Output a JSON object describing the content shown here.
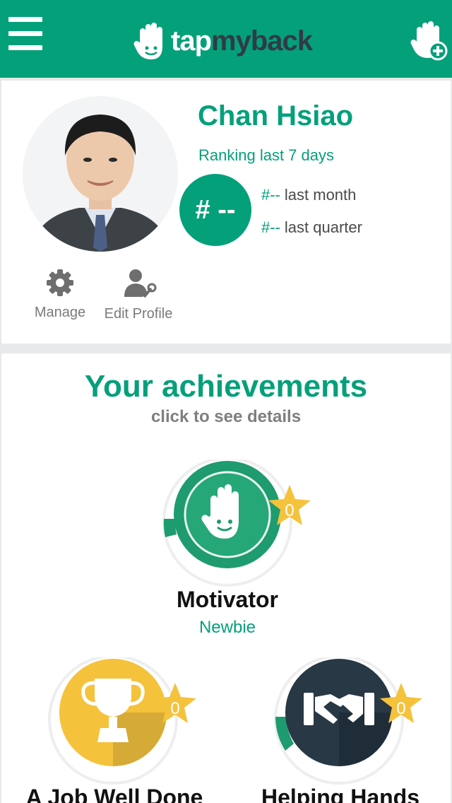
{
  "header": {
    "logo_prefix": "tap",
    "logo_suffix": "myback",
    "menu_icon": "hamburger-icon",
    "add_icon": "hand-plus-icon",
    "brand_color": "#04a07a"
  },
  "profile": {
    "name": "Chan Hsiao",
    "ranking_label": "Ranking last 7 days",
    "rank_value": "# --",
    "last_month_value": "#--",
    "last_month_label": "last month",
    "last_quarter_value": "#--",
    "last_quarter_label": "last quarter",
    "actions": [
      {
        "label": "Manage",
        "icon": "gear-icon"
      },
      {
        "label": "Edit Profile",
        "icon": "user-wrench-icon"
      }
    ]
  },
  "achievements": {
    "title": "Your achievements",
    "subtitle": "click to see details",
    "badges": [
      {
        "name": "Motivator",
        "level": "Newbie",
        "stars": "0",
        "color": "#1e9b6f",
        "icon": "hand-smile-icon"
      },
      {
        "name": "A Job Well Done",
        "stars": "0",
        "color": "#f5c23c",
        "icon": "trophy-icon"
      },
      {
        "name": "Helping Hands",
        "stars": "0",
        "color": "#283845",
        "icon": "handshake-icon"
      }
    ]
  }
}
